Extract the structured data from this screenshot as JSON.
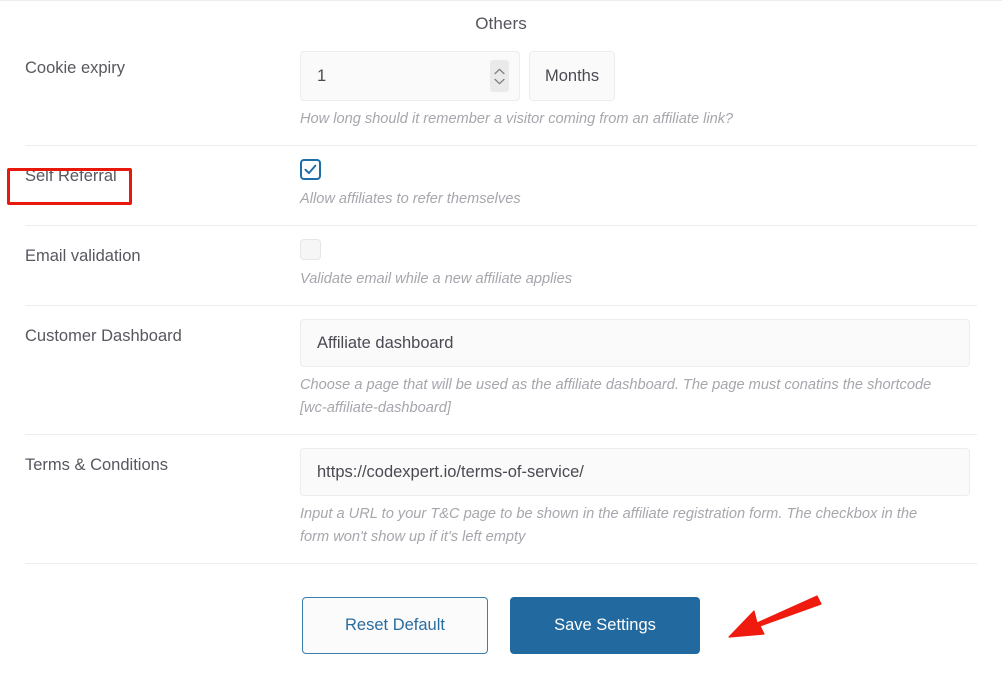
{
  "section": {
    "title": "Others"
  },
  "rows": [
    {
      "label": "Cookie expiry",
      "value": "1",
      "unit": "Months",
      "help": "How long should it remember a visitor coming from an affiliate link?"
    },
    {
      "label": "Self Referral",
      "checked": true,
      "help": "Allow affiliates to refer themselves"
    },
    {
      "label": "Email validation",
      "checked": false,
      "help": "Validate email while a new affiliate applies"
    },
    {
      "label": "Customer Dashboard",
      "value": "Affiliate dashboard",
      "help": "Choose a page that will be used as the affiliate dashboard. The page must conatins the shortcode [wc-affiliate-dashboard]"
    },
    {
      "label": "Terms & Conditions",
      "value": "https://codexpert.io/terms-of-service/",
      "help": "Input a URL to your T&C page to be shown in the affiliate registration form. The checkbox in the form won't show up if it's left empty"
    }
  ],
  "actions": {
    "reset_label": "Reset Default",
    "save_label": "Save Settings"
  },
  "annotations": {
    "highlight_color": "#e8180c",
    "arrow_color": "#ef1b0e",
    "highlight_target": "Self Referral",
    "arrow_target": "Save Settings"
  },
  "colors": {
    "primary_button": "#22699f",
    "secondary_text": "#2b6c9e",
    "checkbox_checked": "#1e6ea8",
    "label_text": "#57575f",
    "help_text": "#a6a6ad"
  },
  "icons": {
    "spinner_up": "chevron-up-icon",
    "spinner_down": "chevron-down-icon",
    "check": "check-icon"
  }
}
